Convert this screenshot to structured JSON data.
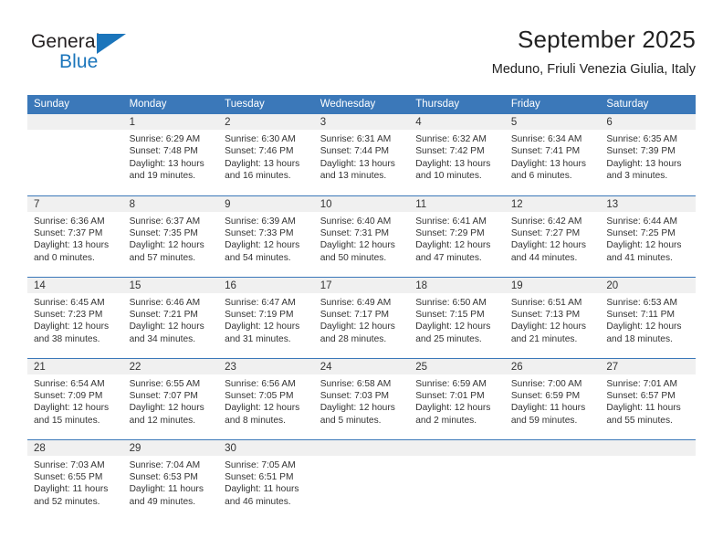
{
  "brand": {
    "name_top": "General",
    "name_bottom": "Blue",
    "flag_icon": "blue-triangle-flag",
    "color_dark": "#231f20",
    "color_blue": "#1b75bb"
  },
  "header": {
    "title": "September 2025",
    "subtitle": "Meduno, Friuli Venezia Giulia, Italy"
  },
  "theme": {
    "header_bg": "#3b78b9",
    "header_text": "#ffffff",
    "daynum_bg": "#f0f0f0",
    "row_rule": "#3b78b9",
    "body_text": "#333333"
  },
  "weekdays": [
    "Sunday",
    "Monday",
    "Tuesday",
    "Wednesday",
    "Thursday",
    "Friday",
    "Saturday"
  ],
  "weeks": [
    [
      {
        "empty": true
      },
      {
        "day": "1",
        "sunrise": "Sunrise: 6:29 AM",
        "sunset": "Sunset: 7:48 PM",
        "daylight_1": "Daylight: 13 hours",
        "daylight_2": "and 19 minutes."
      },
      {
        "day": "2",
        "sunrise": "Sunrise: 6:30 AM",
        "sunset": "Sunset: 7:46 PM",
        "daylight_1": "Daylight: 13 hours",
        "daylight_2": "and 16 minutes."
      },
      {
        "day": "3",
        "sunrise": "Sunrise: 6:31 AM",
        "sunset": "Sunset: 7:44 PM",
        "daylight_1": "Daylight: 13 hours",
        "daylight_2": "and 13 minutes."
      },
      {
        "day": "4",
        "sunrise": "Sunrise: 6:32 AM",
        "sunset": "Sunset: 7:42 PM",
        "daylight_1": "Daylight: 13 hours",
        "daylight_2": "and 10 minutes."
      },
      {
        "day": "5",
        "sunrise": "Sunrise: 6:34 AM",
        "sunset": "Sunset: 7:41 PM",
        "daylight_1": "Daylight: 13 hours",
        "daylight_2": "and 6 minutes."
      },
      {
        "day": "6",
        "sunrise": "Sunrise: 6:35 AM",
        "sunset": "Sunset: 7:39 PM",
        "daylight_1": "Daylight: 13 hours",
        "daylight_2": "and 3 minutes."
      }
    ],
    [
      {
        "day": "7",
        "sunrise": "Sunrise: 6:36 AM",
        "sunset": "Sunset: 7:37 PM",
        "daylight_1": "Daylight: 13 hours",
        "daylight_2": "and 0 minutes."
      },
      {
        "day": "8",
        "sunrise": "Sunrise: 6:37 AM",
        "sunset": "Sunset: 7:35 PM",
        "daylight_1": "Daylight: 12 hours",
        "daylight_2": "and 57 minutes."
      },
      {
        "day": "9",
        "sunrise": "Sunrise: 6:39 AM",
        "sunset": "Sunset: 7:33 PM",
        "daylight_1": "Daylight: 12 hours",
        "daylight_2": "and 54 minutes."
      },
      {
        "day": "10",
        "sunrise": "Sunrise: 6:40 AM",
        "sunset": "Sunset: 7:31 PM",
        "daylight_1": "Daylight: 12 hours",
        "daylight_2": "and 50 minutes."
      },
      {
        "day": "11",
        "sunrise": "Sunrise: 6:41 AM",
        "sunset": "Sunset: 7:29 PM",
        "daylight_1": "Daylight: 12 hours",
        "daylight_2": "and 47 minutes."
      },
      {
        "day": "12",
        "sunrise": "Sunrise: 6:42 AM",
        "sunset": "Sunset: 7:27 PM",
        "daylight_1": "Daylight: 12 hours",
        "daylight_2": "and 44 minutes."
      },
      {
        "day": "13",
        "sunrise": "Sunrise: 6:44 AM",
        "sunset": "Sunset: 7:25 PM",
        "daylight_1": "Daylight: 12 hours",
        "daylight_2": "and 41 minutes."
      }
    ],
    [
      {
        "day": "14",
        "sunrise": "Sunrise: 6:45 AM",
        "sunset": "Sunset: 7:23 PM",
        "daylight_1": "Daylight: 12 hours",
        "daylight_2": "and 38 minutes."
      },
      {
        "day": "15",
        "sunrise": "Sunrise: 6:46 AM",
        "sunset": "Sunset: 7:21 PM",
        "daylight_1": "Daylight: 12 hours",
        "daylight_2": "and 34 minutes."
      },
      {
        "day": "16",
        "sunrise": "Sunrise: 6:47 AM",
        "sunset": "Sunset: 7:19 PM",
        "daylight_1": "Daylight: 12 hours",
        "daylight_2": "and 31 minutes."
      },
      {
        "day": "17",
        "sunrise": "Sunrise: 6:49 AM",
        "sunset": "Sunset: 7:17 PM",
        "daylight_1": "Daylight: 12 hours",
        "daylight_2": "and 28 minutes."
      },
      {
        "day": "18",
        "sunrise": "Sunrise: 6:50 AM",
        "sunset": "Sunset: 7:15 PM",
        "daylight_1": "Daylight: 12 hours",
        "daylight_2": "and 25 minutes."
      },
      {
        "day": "19",
        "sunrise": "Sunrise: 6:51 AM",
        "sunset": "Sunset: 7:13 PM",
        "daylight_1": "Daylight: 12 hours",
        "daylight_2": "and 21 minutes."
      },
      {
        "day": "20",
        "sunrise": "Sunrise: 6:53 AM",
        "sunset": "Sunset: 7:11 PM",
        "daylight_1": "Daylight: 12 hours",
        "daylight_2": "and 18 minutes."
      }
    ],
    [
      {
        "day": "21",
        "sunrise": "Sunrise: 6:54 AM",
        "sunset": "Sunset: 7:09 PM",
        "daylight_1": "Daylight: 12 hours",
        "daylight_2": "and 15 minutes."
      },
      {
        "day": "22",
        "sunrise": "Sunrise: 6:55 AM",
        "sunset": "Sunset: 7:07 PM",
        "daylight_1": "Daylight: 12 hours",
        "daylight_2": "and 12 minutes."
      },
      {
        "day": "23",
        "sunrise": "Sunrise: 6:56 AM",
        "sunset": "Sunset: 7:05 PM",
        "daylight_1": "Daylight: 12 hours",
        "daylight_2": "and 8 minutes."
      },
      {
        "day": "24",
        "sunrise": "Sunrise: 6:58 AM",
        "sunset": "Sunset: 7:03 PM",
        "daylight_1": "Daylight: 12 hours",
        "daylight_2": "and 5 minutes."
      },
      {
        "day": "25",
        "sunrise": "Sunrise: 6:59 AM",
        "sunset": "Sunset: 7:01 PM",
        "daylight_1": "Daylight: 12 hours",
        "daylight_2": "and 2 minutes."
      },
      {
        "day": "26",
        "sunrise": "Sunrise: 7:00 AM",
        "sunset": "Sunset: 6:59 PM",
        "daylight_1": "Daylight: 11 hours",
        "daylight_2": "and 59 minutes."
      },
      {
        "day": "27",
        "sunrise": "Sunrise: 7:01 AM",
        "sunset": "Sunset: 6:57 PM",
        "daylight_1": "Daylight: 11 hours",
        "daylight_2": "and 55 minutes."
      }
    ],
    [
      {
        "day": "28",
        "sunrise": "Sunrise: 7:03 AM",
        "sunset": "Sunset: 6:55 PM",
        "daylight_1": "Daylight: 11 hours",
        "daylight_2": "and 52 minutes."
      },
      {
        "day": "29",
        "sunrise": "Sunrise: 7:04 AM",
        "sunset": "Sunset: 6:53 PM",
        "daylight_1": "Daylight: 11 hours",
        "daylight_2": "and 49 minutes."
      },
      {
        "day": "30",
        "sunrise": "Sunrise: 7:05 AM",
        "sunset": "Sunset: 6:51 PM",
        "daylight_1": "Daylight: 11 hours",
        "daylight_2": "and 46 minutes."
      },
      {
        "empty": true
      },
      {
        "empty": true
      },
      {
        "empty": true
      },
      {
        "empty": true
      }
    ]
  ]
}
